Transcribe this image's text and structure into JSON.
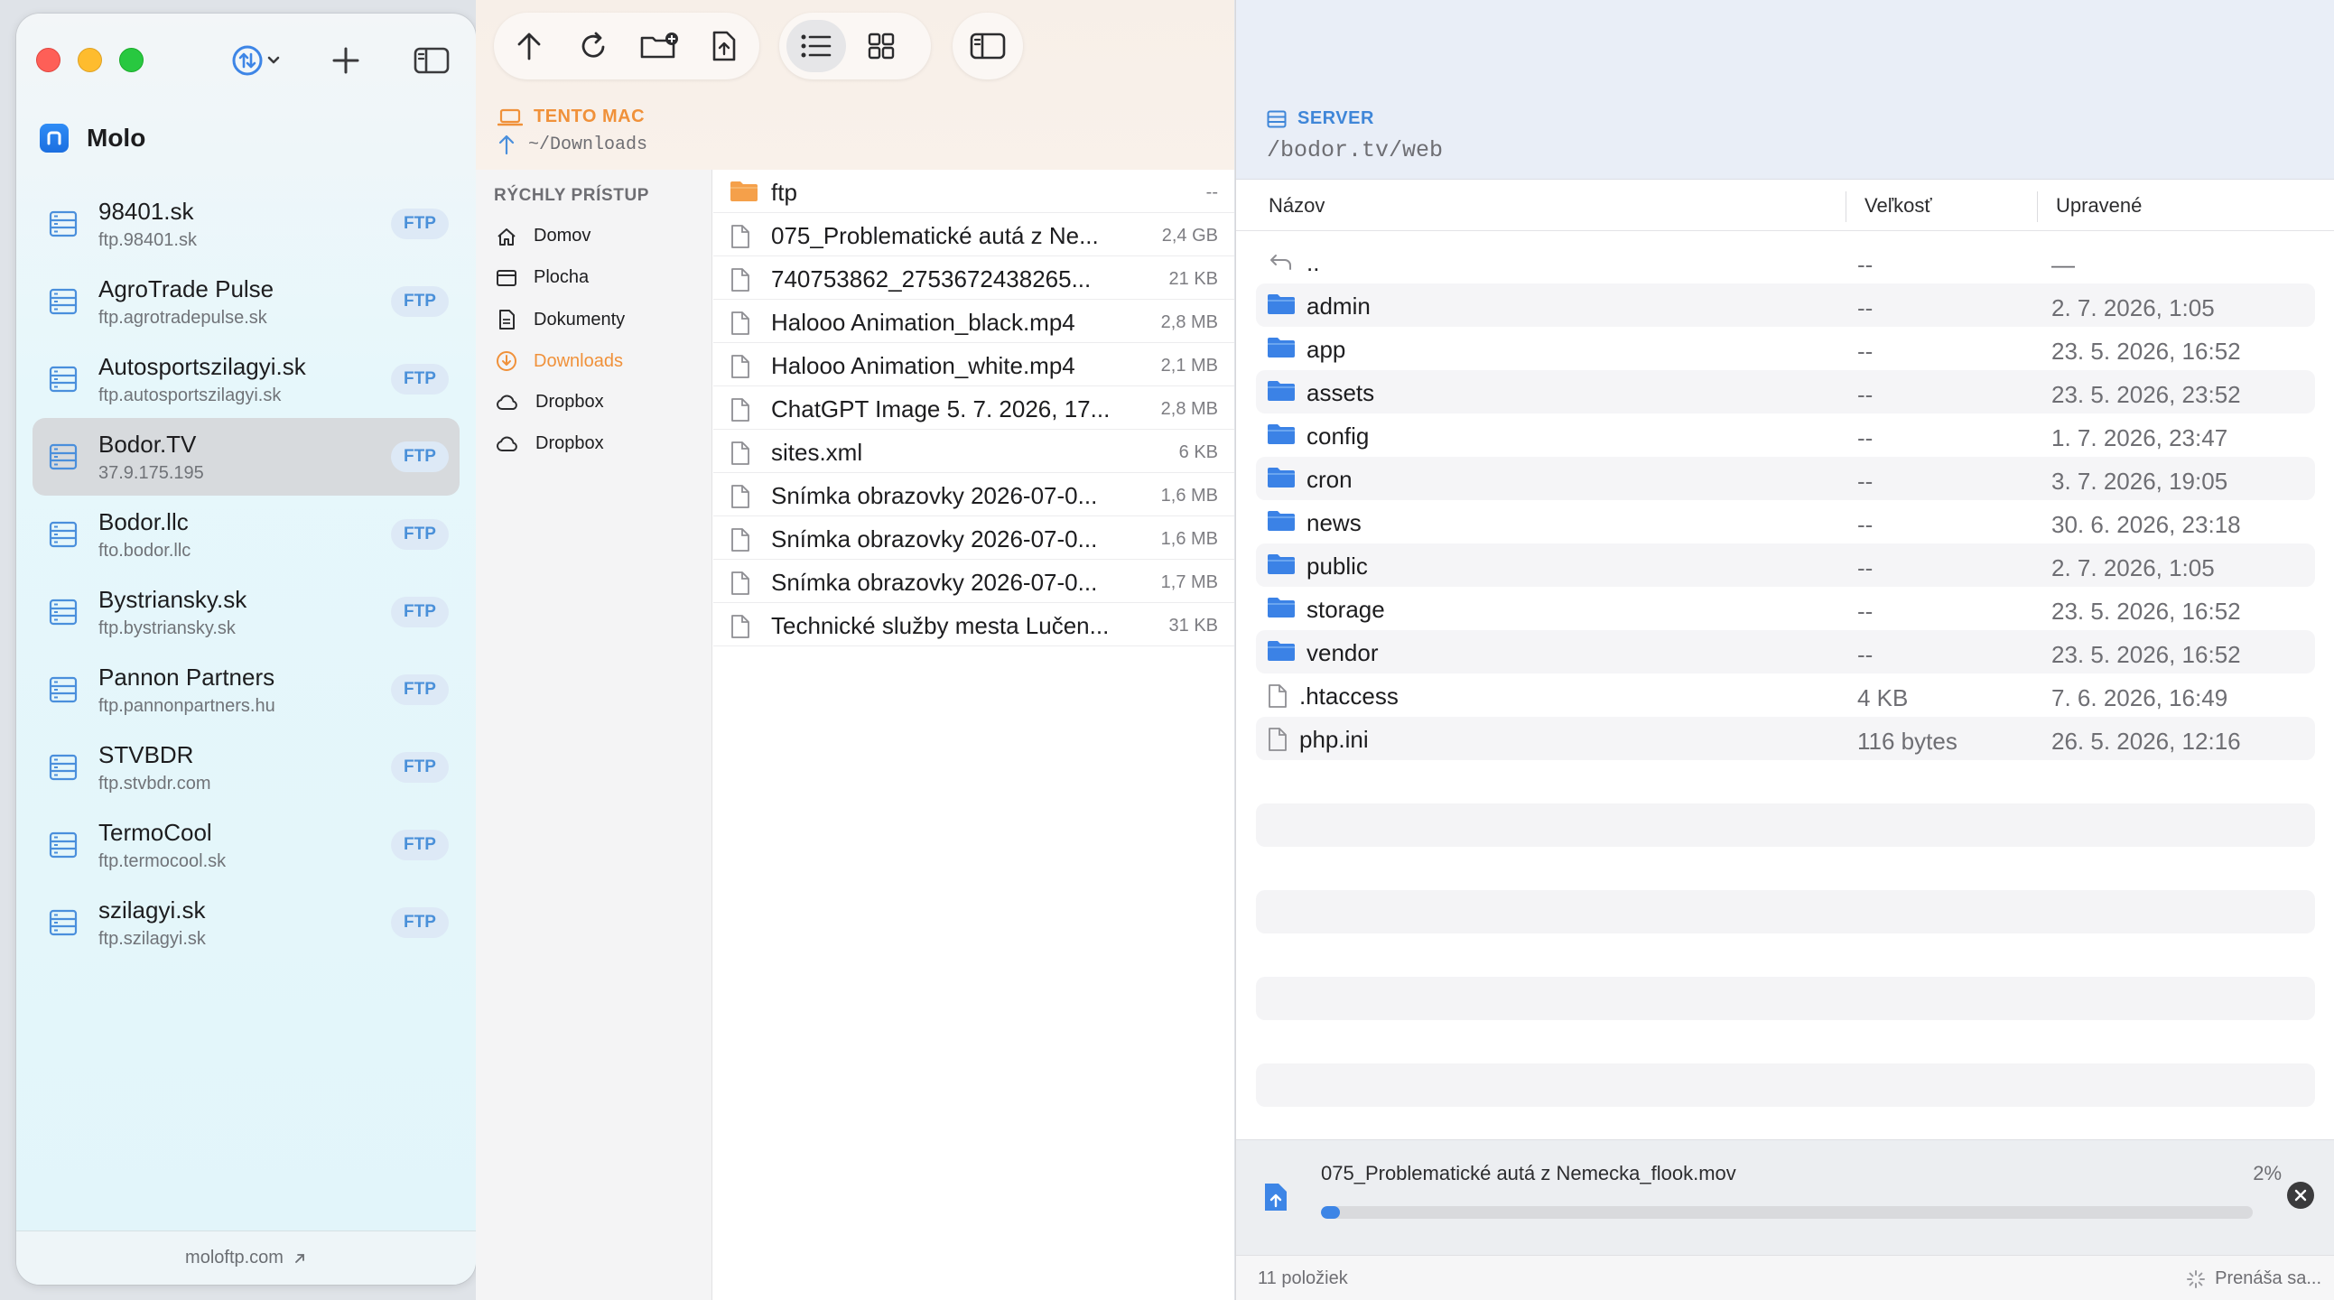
{
  "app": {
    "name": "Molo"
  },
  "sidebar": {
    "footer_link": "moloftp.com",
    "servers": [
      {
        "name": "98401.sk",
        "host": "ftp.98401.sk",
        "protocol": "FTP"
      },
      {
        "name": "AgroTrade Pulse",
        "host": "ftp.agrotradepulse.sk",
        "protocol": "FTP"
      },
      {
        "name": "Autosportszilagyi.sk",
        "host": "ftp.autosportszilagyi.sk",
        "protocol": "FTP"
      },
      {
        "name": "Bodor.TV",
        "host": "37.9.175.195",
        "protocol": "FTP",
        "selected": true
      },
      {
        "name": "Bodor.llc",
        "host": "fto.bodor.llc",
        "protocol": "FTP"
      },
      {
        "name": "Bystriansky.sk",
        "host": "ftp.bystriansky.sk",
        "protocol": "FTP"
      },
      {
        "name": "Pannon Partners",
        "host": "ftp.pannonpartners.hu",
        "protocol": "FTP"
      },
      {
        "name": "STVBDR",
        "host": "ftp.stvbdr.com",
        "protocol": "FTP"
      },
      {
        "name": "TermoCool",
        "host": "ftp.termocool.sk",
        "protocol": "FTP"
      },
      {
        "name": "szilagyi.sk",
        "host": "ftp.szilagyi.sk",
        "protocol": "FTP"
      }
    ]
  },
  "local": {
    "location_label": "TENTO MAC",
    "path": "~/Downloads",
    "quick_access_title": "RÝCHLY PRÍSTUP",
    "quick_access": [
      {
        "label": "Domov",
        "icon": "home-icon"
      },
      {
        "label": "Plocha",
        "icon": "desktop-icon"
      },
      {
        "label": "Dokumenty",
        "icon": "document-icon"
      },
      {
        "label": "Downloads",
        "icon": "download-icon",
        "active": true
      },
      {
        "label": "Dropbox",
        "icon": "cloud-icon"
      },
      {
        "label": "Dropbox",
        "icon": "cloud-icon"
      }
    ],
    "files": [
      {
        "name": "ftp",
        "size": "--",
        "type": "folder"
      },
      {
        "name": "075_Problematické autá z Ne...",
        "size": "2,4 GB",
        "type": "file"
      },
      {
        "name": "740753862_2753672438265...",
        "size": "21 KB",
        "type": "file"
      },
      {
        "name": "Halooo Animation_black.mp4",
        "size": "2,8 MB",
        "type": "file"
      },
      {
        "name": "Halooo Animation_white.mp4",
        "size": "2,1 MB",
        "type": "file"
      },
      {
        "name": "ChatGPT Image 5. 7. 2026, 17...",
        "size": "2,8 MB",
        "type": "file"
      },
      {
        "name": "sites.xml",
        "size": "6 KB",
        "type": "file"
      },
      {
        "name": "Snímka obrazovky 2026-07-0...",
        "size": "1,6 MB",
        "type": "file"
      },
      {
        "name": "Snímka obrazovky 2026-07-0...",
        "size": "1,6 MB",
        "type": "file"
      },
      {
        "name": "Snímka obrazovky 2026-07-0...",
        "size": "1,7 MB",
        "type": "file"
      },
      {
        "name": "Technické služby mesta Lučen...",
        "size": "31 KB",
        "type": "file"
      }
    ]
  },
  "remote": {
    "location_label": "SERVER",
    "path": "/bodor.tv/web",
    "columns": {
      "name": "Názov",
      "size": "Veľkosť",
      "modified": "Upravené"
    },
    "parent_row": {
      "name": "..",
      "size": "--",
      "modified": "—"
    },
    "rows": [
      {
        "name": "admin",
        "size": "--",
        "modified": "2. 7. 2026, 1:05",
        "type": "folder"
      },
      {
        "name": "app",
        "size": "--",
        "modified": "23. 5. 2026, 16:52",
        "type": "folder"
      },
      {
        "name": "assets",
        "size": "--",
        "modified": "23. 5. 2026, 23:52",
        "type": "folder"
      },
      {
        "name": "config",
        "size": "--",
        "modified": "1. 7. 2026, 23:47",
        "type": "folder"
      },
      {
        "name": "cron",
        "size": "--",
        "modified": "3. 7. 2026, 19:05",
        "type": "folder"
      },
      {
        "name": "news",
        "size": "--",
        "modified": "30. 6. 2026, 23:18",
        "type": "folder"
      },
      {
        "name": "public",
        "size": "--",
        "modified": "2. 7. 2026, 1:05",
        "type": "folder"
      },
      {
        "name": "storage",
        "size": "--",
        "modified": "23. 5. 2026, 16:52",
        "type": "folder"
      },
      {
        "name": "vendor",
        "size": "--",
        "modified": "23. 5. 2026, 16:52",
        "type": "folder"
      },
      {
        "name": ".htaccess",
        "size": "4 KB",
        "modified": "7. 6. 2026, 16:49",
        "type": "file"
      },
      {
        "name": "php.ini",
        "size": "116 bytes",
        "modified": "26. 5. 2026, 12:16",
        "type": "file"
      }
    ],
    "transfer": {
      "file": "075_Problematické autá z Nemecka_flook.mov",
      "percent_label": "2%",
      "progress": 0.02
    },
    "status": {
      "count": "11 položiek",
      "state": "Prenáša sa..."
    }
  },
  "colors": {
    "accent_blue": "#3d85e6",
    "local_accent": "#f0913a",
    "server_accent": "#3f86d8"
  }
}
